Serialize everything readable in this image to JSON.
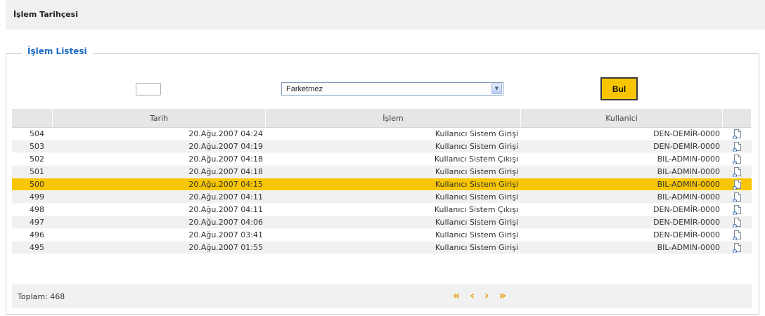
{
  "page": {
    "title": "İşlem Tarihçesi"
  },
  "panel": {
    "legend": "İşlem Listesi"
  },
  "filter": {
    "select_value": "Farketmez",
    "find_label": "Bul"
  },
  "table": {
    "headers": [
      "Tarih",
      "İşlem",
      "Kullanici"
    ],
    "rows": [
      {
        "id": "504",
        "date": "20.Ağu.2007 04:24",
        "op": "Kullanıcı Sistem Girişi",
        "user": "DEN-DEMİR-0000"
      },
      {
        "id": "503",
        "date": "20.Ağu.2007 04:19",
        "op": "Kullanıcı Sistem Girişi",
        "user": "DEN-DEMİR-0000"
      },
      {
        "id": "502",
        "date": "20.Ağu.2007 04:18",
        "op": "Kullanıcı Sistem Çıkışı",
        "user": "BIL-ADMIN-0000"
      },
      {
        "id": "501",
        "date": "20.Ağu.2007 04:18",
        "op": "Kullanıcı Sistem Girişi",
        "user": "BIL-ADMIN-0000"
      },
      {
        "id": "500",
        "date": "20.Ağu.2007 04:15",
        "op": "Kullanıcı Sistem Girişi",
        "user": "BIL-ADMIN-0000"
      },
      {
        "id": "499",
        "date": "20.Ağu.2007 04:11",
        "op": "Kullanıcı Sistem Girişi",
        "user": "BIL-ADMIN-0000"
      },
      {
        "id": "498",
        "date": "20.Ağu.2007 04:11",
        "op": "Kullanıcı Sistem Çıkışı",
        "user": "DEN-DEMİR-0000"
      },
      {
        "id": "497",
        "date": "20.Ağu.2007 04:06",
        "op": "Kullanıcı Sistem Girişi",
        "user": "DEN-DEMİR-0000"
      },
      {
        "id": "496",
        "date": "20.Ağu.2007 03:41",
        "op": "Kullanıcı Sistem Girişi",
        "user": "DEN-DEMİR-0000"
      },
      {
        "id": "495",
        "date": "20.Ağu.2007 01:55",
        "op": "Kullanıcı Sistem Girişi",
        "user": "BIL-ADMIN-0000"
      }
    ],
    "selected_id": "500",
    "row_icon": "document-view-icon"
  },
  "footer": {
    "total": "Toplam: 468",
    "pager": {
      "first": "«",
      "prev": "‹",
      "next": "›",
      "last": "»"
    }
  },
  "colors": {
    "accent": "#f7c600",
    "legend": "#1d6ac6",
    "pager": "#e79d00"
  }
}
